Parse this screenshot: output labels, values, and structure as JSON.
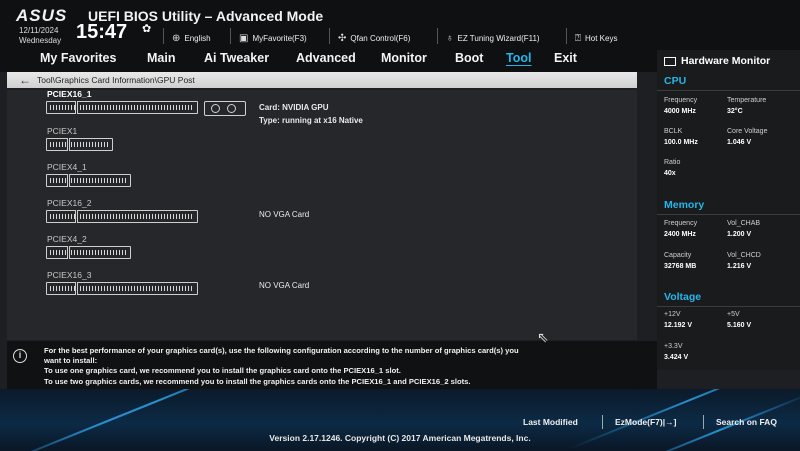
{
  "header": {
    "logo": "ASUS",
    "title": "UEFI BIOS Utility – Advanced Mode",
    "date": "12/11/2024",
    "weekday": "Wednesday",
    "time": "15:47",
    "language": "English",
    "my_favorite": "MyFavorite(F3)",
    "qfan": "Qfan Control(F6)",
    "ez_tuning": "EZ Tuning Wizard(F11)",
    "hot_keys": "Hot Keys"
  },
  "menu": {
    "items": [
      {
        "label": "My Favorites"
      },
      {
        "label": "Main"
      },
      {
        "label": "Ai Tweaker"
      },
      {
        "label": "Advanced"
      },
      {
        "label": "Monitor"
      },
      {
        "label": "Boot"
      },
      {
        "label": "Tool"
      },
      {
        "label": "Exit"
      }
    ],
    "active": "Tool"
  },
  "breadcrumb": "Tool\\Graphics Card Information\\GPU Post",
  "slots": [
    {
      "name": "PCIEX16_1",
      "info_line1": "Card: NVIDIA GPU",
      "info_line2": "Type: running at x16 Native"
    },
    {
      "name": "PCIEX1",
      "info_line1": ""
    },
    {
      "name": "PCIEX4_1",
      "info_line1": ""
    },
    {
      "name": "PCIEX16_2",
      "info_line1": "NO VGA Card"
    },
    {
      "name": "PCIEX4_2",
      "info_line1": ""
    },
    {
      "name": "PCIEX16_3",
      "info_line1": "NO VGA Card"
    }
  ],
  "hardware_monitor": {
    "title": "Hardware Monitor",
    "cpu": {
      "heading": "CPU",
      "frequency_label": "Frequency",
      "frequency": "4000 MHz",
      "temperature_label": "Temperature",
      "temperature": "32°C",
      "bclk_label": "BCLK",
      "bclk": "100.0 MHz",
      "core_voltage_label": "Core Voltage",
      "core_voltage": "1.046 V",
      "ratio_label": "Ratio",
      "ratio": "40x"
    },
    "memory": {
      "heading": "Memory",
      "frequency_label": "Frequency",
      "frequency": "2400 MHz",
      "vol_chab_label": "Vol_CHAB",
      "vol_chab": "1.200 V",
      "capacity_label": "Capacity",
      "capacity": "32768 MB",
      "vol_chcd_label": "Vol_CHCD",
      "vol_chcd": "1.216 V"
    },
    "voltage": {
      "heading": "Voltage",
      "v12_label": "+12V",
      "v12": "12.192 V",
      "v5_label": "+5V",
      "v5": "5.160 V",
      "v33_label": "+3.3V",
      "v33": "3.424 V"
    }
  },
  "info": {
    "line1": "For the best performance of your graphics card(s), use the following configuration according to the number of graphics card(s) you",
    "line2": "want to install:",
    "line3": "To use one graphics card, we recommend you to install  the graphics card onto the PCIEX16_1 slot.",
    "line4": "To use two graphics cards, we recommend you to install the graphics cards onto the PCIEX16_1 and PCIEX16_2 slots."
  },
  "footer": {
    "last_modified": "Last Modified",
    "ez_mode": "EzMode(F7)|→]",
    "search_faq": "Search on FAQ",
    "version": "Version 2.17.1246. Copyright (C) 2017 American Megatrends, Inc."
  },
  "colors": {
    "accent": "#25b6e9",
    "background": "#1d1f22",
    "panel": "#25272a"
  },
  "icons": {
    "globe": "globe-icon",
    "favorite": "monitor-star-icon",
    "fan": "fan-icon",
    "bulb": "lightbulb-icon",
    "help": "question-icon",
    "back": "arrow-left-icon",
    "info": "info-icon",
    "monitor": "monitor-icon"
  }
}
